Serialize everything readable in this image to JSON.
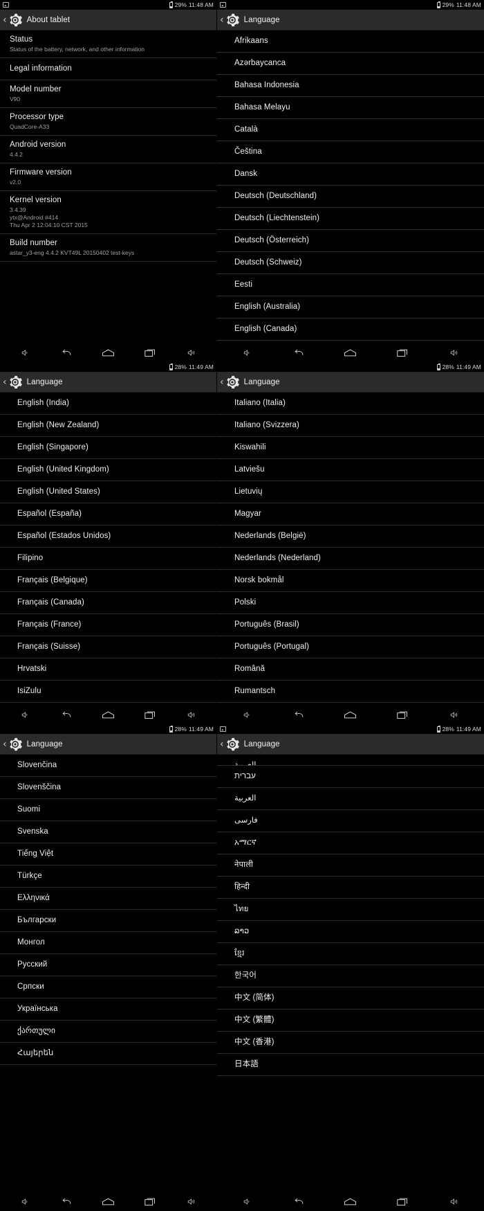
{
  "colors": {
    "background": "#000000",
    "actionbar": "#2b2b2b",
    "divider": "#303030",
    "primary_text": "#f0f0f0",
    "secondary_text": "#a0a0a0"
  },
  "icons": {
    "screenshot": "screenshot-icon",
    "battery": "battery-icon",
    "gear": "gear-icon",
    "back_caret": "back-caret-icon",
    "volume_down": "volume-down-icon",
    "back": "back-icon",
    "home": "home-icon",
    "recents": "recents-icon",
    "volume_up": "volume-up-icon"
  },
  "navbar": {
    "buttons": [
      {
        "name": "volume-down-button",
        "label": "Volume down"
      },
      {
        "name": "back-button",
        "label": "Back"
      },
      {
        "name": "home-button",
        "label": "Home"
      },
      {
        "name": "recents-button",
        "label": "Recent apps"
      },
      {
        "name": "volume-up-button",
        "label": "Volume up"
      }
    ]
  },
  "panels": [
    {
      "id": "about-tablet",
      "status": {
        "battery": "29%",
        "time": "11:48 AM"
      },
      "title": "About tablet",
      "items": [
        {
          "title": "Status",
          "sub": "Status of the battery, network, and other information"
        },
        {
          "title": "Legal information",
          "sub": ""
        },
        {
          "title": "Model number",
          "sub": "V90"
        },
        {
          "title": "Processor type",
          "sub": "QuadCore-A33"
        },
        {
          "title": "Android version",
          "sub": "4.4.2"
        },
        {
          "title": "Firmware version",
          "sub": "v2.0"
        },
        {
          "title": "Kernel version",
          "sub": "3.4.39\nytx@Android #414\nThu Apr 2 12:04:10 CST 2015"
        },
        {
          "title": "Build number",
          "sub": "astar_y3-eng 4.4.2 KVT49L 20150402 test-keys"
        }
      ]
    },
    {
      "id": "language-1",
      "status": {
        "battery": "29%",
        "time": "11:48 AM"
      },
      "title": "Language",
      "languages": [
        "Afrikaans",
        "Azərbaycanca",
        "Bahasa Indonesia",
        "Bahasa Melayu",
        "Català",
        "Čeština",
        "Dansk",
        "Deutsch (Deutschland)",
        "Deutsch (Liechtenstein)",
        "Deutsch (Österreich)",
        "Deutsch (Schweiz)",
        "Eesti",
        "English (Australia)",
        "English (Canada)"
      ]
    },
    {
      "id": "language-2",
      "status": {
        "battery": "28%",
        "time": "11:49 AM"
      },
      "title": "Language",
      "languages": [
        "English (India)",
        "English (New Zealand)",
        "English (Singapore)",
        "English (United Kingdom)",
        "English (United States)",
        "Español (España)",
        "Español (Estados Unidos)",
        "Filipino",
        "Français (Belgique)",
        "Français (Canada)",
        "Français (France)",
        "Français (Suisse)",
        "Hrvatski",
        "IsiZulu"
      ]
    },
    {
      "id": "language-3",
      "status": {
        "battery": "28%",
        "time": "11:49 AM"
      },
      "title": "Language",
      "languages": [
        "Italiano (Italia)",
        "Italiano (Svizzera)",
        "Kiswahili",
        "Latviešu",
        "Lietuvių",
        "Magyar",
        "Nederlands (België)",
        "Nederlands (Nederland)",
        "Norsk bokmål",
        "Polski",
        "Português (Brasil)",
        "Português (Portugal)",
        "Română",
        "Rumantsch"
      ]
    },
    {
      "id": "language-4",
      "status": {
        "battery": "28%",
        "time": "11:49 AM"
      },
      "title": "Language",
      "languages": [
        "Slovenčina",
        "Slovenščina",
        "Suomi",
        "Svenska",
        "Tiếng Việt",
        "Türkçe",
        "Ελληνικά",
        "Български",
        "Монгол",
        "Русский",
        "Српски",
        "Українська",
        "ქართული",
        "Հայերեն"
      ]
    },
    {
      "id": "language-5",
      "status": {
        "battery": "28%",
        "time": "11:49 AM"
      },
      "title": "Language",
      "clipped_first": "العربية",
      "languages": [
        "עברית",
        "العربية",
        "فارسی",
        "አማርኛ",
        "नेपाली",
        "हिन्दी",
        "ไทย",
        "ລາວ",
        "ខ្មែរ",
        "한국어",
        "中文 (简体)",
        "中文 (繁體)",
        "中文 (香港)",
        "日本語"
      ]
    }
  ]
}
